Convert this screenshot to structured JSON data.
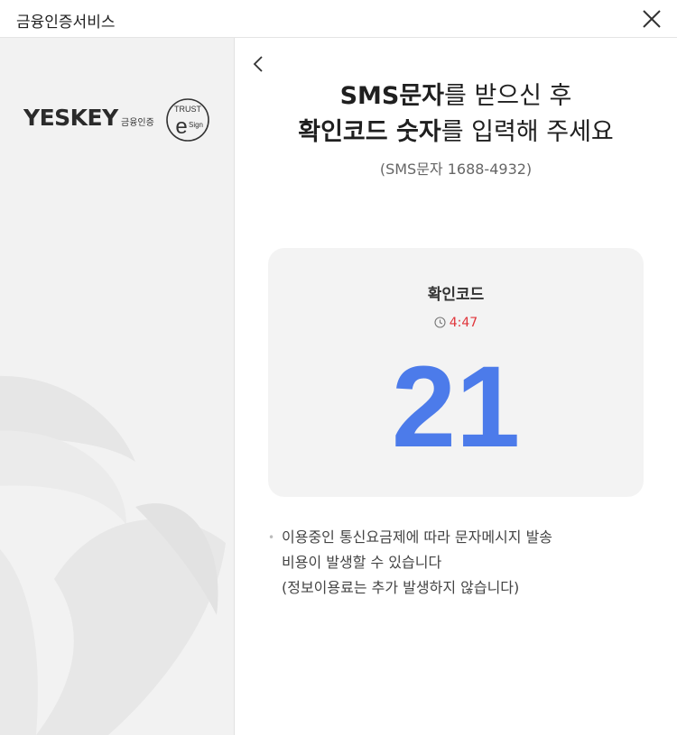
{
  "window": {
    "title": "금융인증서비스",
    "close_icon": "close-icon"
  },
  "brand": {
    "wordmark": "YESKEY",
    "wordmark_suffix": "금융인증",
    "seal_top": "TRUST",
    "seal_letter": "e",
    "seal_side": "Sign"
  },
  "main": {
    "back_icon": "chevron-left-icon",
    "heading_line1_bold": "SMS문자",
    "heading_line1_rest": "를 받으신 후",
    "heading_line2_bold": "확인코드 숫자",
    "heading_line2_rest": "를 입력해 주세요",
    "subheading": "(SMS문자 1688-4932)",
    "card": {
      "label": "확인코드",
      "timer": "4:47",
      "timer_icon": "clock-icon",
      "code": "21"
    },
    "notice": {
      "line1": "이용중인 통신요금제에 따라 문자메시지 발송",
      "line2": "비용이 발생할 수 있습니다",
      "line3": "(정보이용료는 추가 발생하지 않습니다)"
    }
  },
  "colors": {
    "accent": "#4c7bea",
    "timer": "#e0353b",
    "panel": "#f2f2f2"
  }
}
